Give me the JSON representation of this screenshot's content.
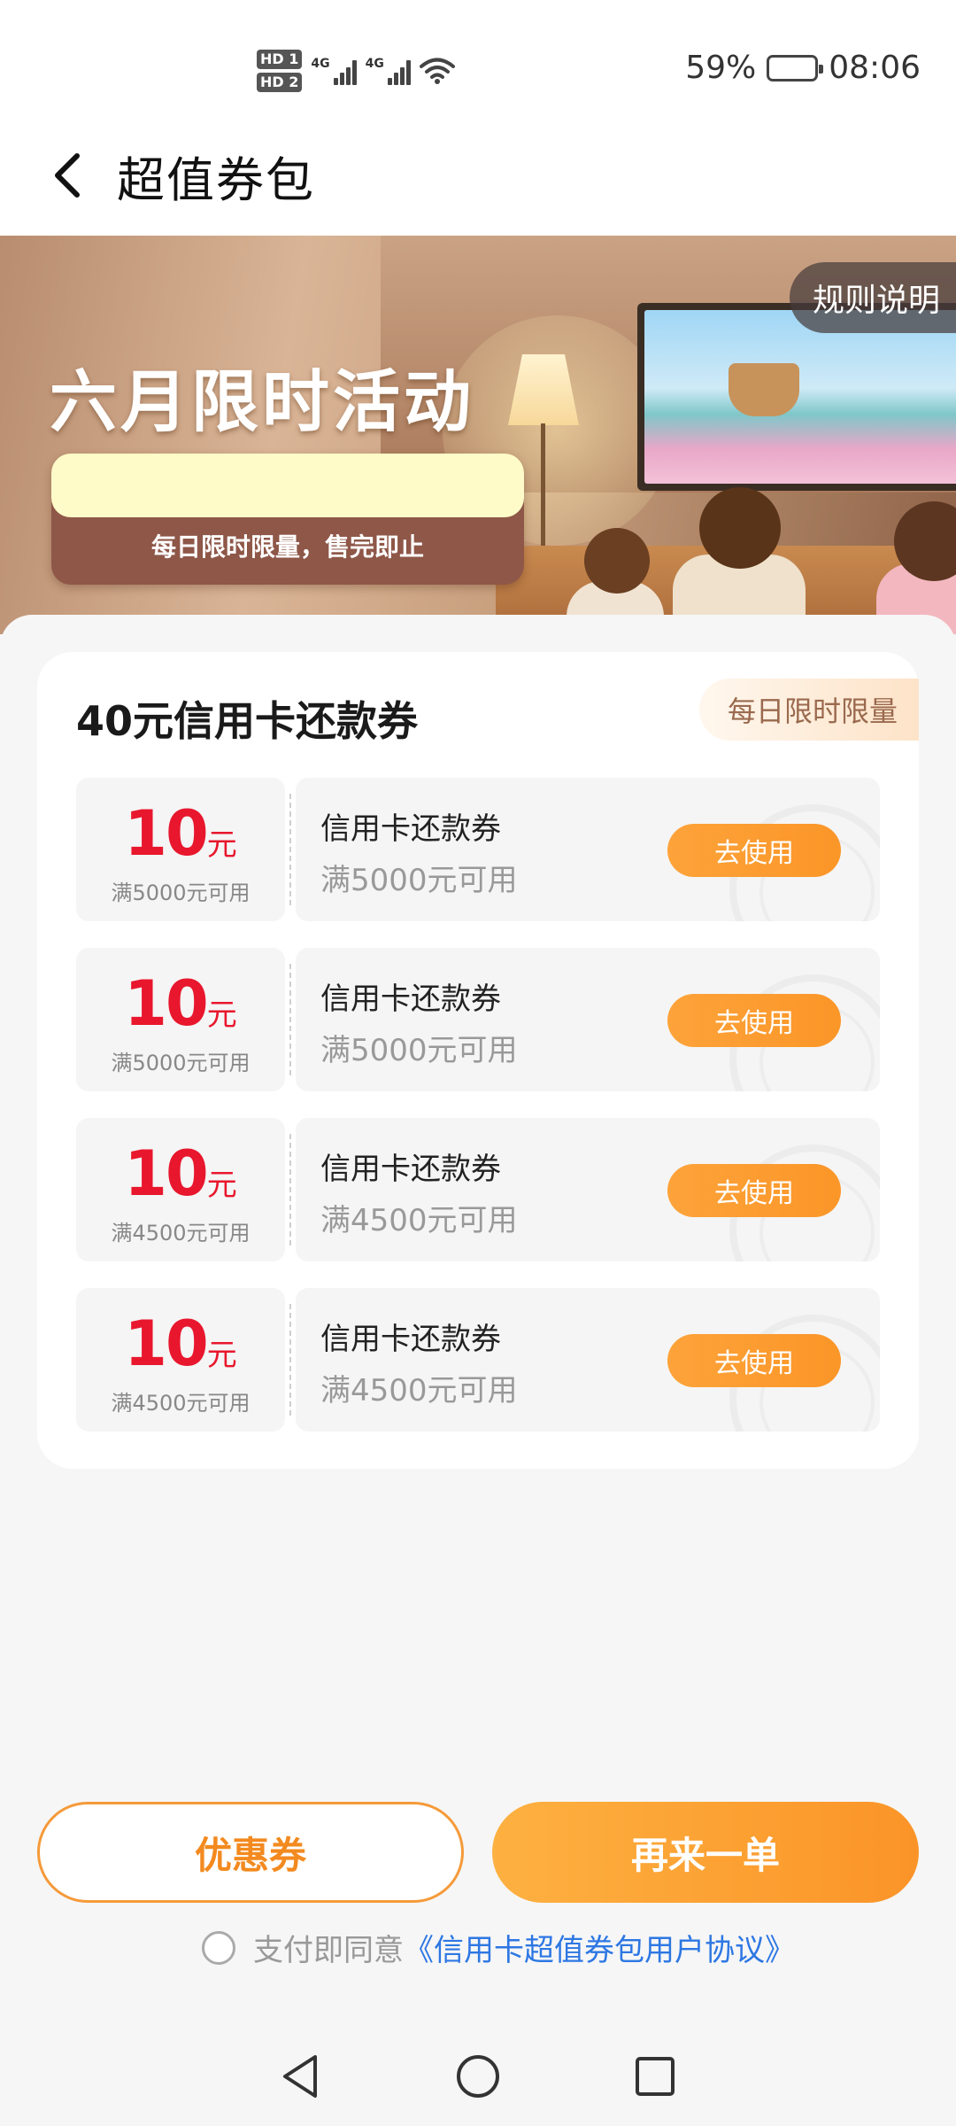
{
  "status_bar": {
    "hd1": "HD",
    "hd1_num": "1",
    "hd2": "HD",
    "hd2_num": "2",
    "net1": "4G",
    "net2": "4G",
    "battery_percent": "59%",
    "battery_level": 0.59,
    "time": "08:06"
  },
  "header": {
    "title": "超值券包",
    "back_icon": "chevron-left-icon"
  },
  "banner": {
    "title": "六月限时活动",
    "subtitle": "每日限时限量，售完即止",
    "rules_label": "规则说明"
  },
  "pack": {
    "title": "40元信用卡还款券",
    "tag": "每日限时限量",
    "coupons": [
      {
        "amount": "10",
        "unit": "元",
        "condition": "满5000元可用",
        "name": "信用卡还款券",
        "detail": "满5000元可用",
        "button": "去使用"
      },
      {
        "amount": "10",
        "unit": "元",
        "condition": "满5000元可用",
        "name": "信用卡还款券",
        "detail": "满5000元可用",
        "button": "去使用"
      },
      {
        "amount": "10",
        "unit": "元",
        "condition": "满4500元可用",
        "name": "信用卡还款券",
        "detail": "满4500元可用",
        "button": "去使用"
      },
      {
        "amount": "10",
        "unit": "元",
        "condition": "满4500元可用",
        "name": "信用卡还款券",
        "detail": "满4500元可用",
        "button": "去使用"
      }
    ]
  },
  "footer": {
    "coupon_button": "优惠券",
    "again_button": "再来一单",
    "agree_text": "支付即同意",
    "agreement_link": "《信用卡超值券包用户协议》"
  },
  "colors": {
    "accent_orange": "#fb9628",
    "amount_red": "#e8172d",
    "link_blue": "#2d77e3"
  }
}
